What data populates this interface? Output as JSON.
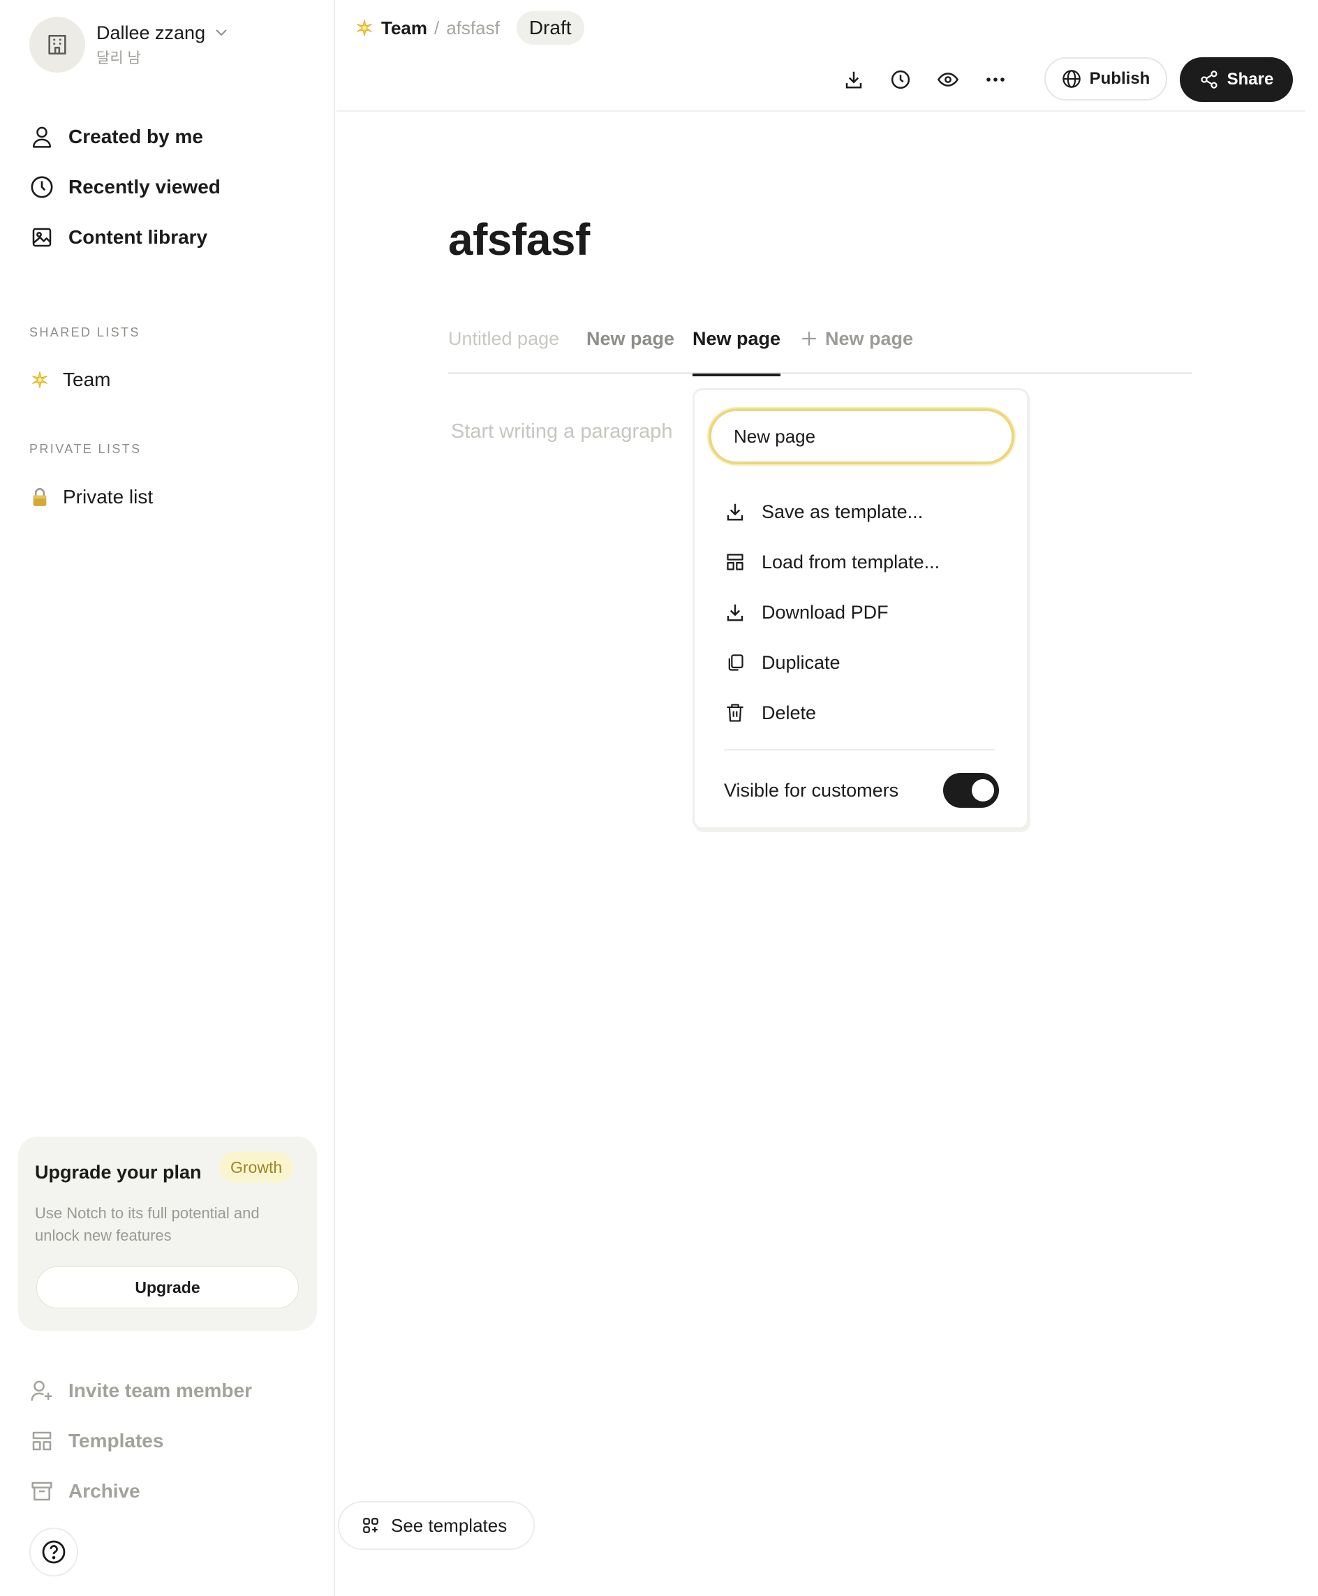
{
  "workspace": {
    "name": "Dallee zzang",
    "subtitle": "달리 남",
    "avatar_icon": "building-icon"
  },
  "sidebar": {
    "nav": [
      {
        "label": "Created by me",
        "icon": "user-icon"
      },
      {
        "label": "Recently viewed",
        "icon": "clock-icon"
      },
      {
        "label": "Content library",
        "icon": "image-icon"
      }
    ],
    "shared_title": "SHARED LISTS",
    "shared_lists": [
      {
        "label": "Team",
        "icon": "sparkle-emoji"
      }
    ],
    "private_title": "PRIVATE LISTS",
    "private_lists": [
      {
        "label": "Private list",
        "icon": "lock-emoji"
      }
    ],
    "upgrade": {
      "title": "Upgrade your plan",
      "badge": "Growth",
      "description": "Use Notch to its full potential and unlock new features",
      "button": "Upgrade"
    },
    "bottom": [
      {
        "label": "Invite team member",
        "icon": "user-plus-icon"
      },
      {
        "label": "Templates",
        "icon": "template-icon"
      },
      {
        "label": "Archive",
        "icon": "archive-icon"
      }
    ],
    "help_icon": "help-icon"
  },
  "header": {
    "breadcrumb_team": "Team",
    "breadcrumb_sep": "/",
    "breadcrumb_page": "afsfasf",
    "status": "Draft",
    "tools": [
      "download-icon",
      "history-icon",
      "eye-icon",
      "more-icon"
    ],
    "publish": "Publish",
    "share": "Share"
  },
  "document": {
    "title": "afsfasf",
    "tabs": [
      "Untitled page",
      "New page",
      "New page"
    ],
    "active_tab": 2,
    "add_tab": "New page",
    "placeholder": "Start writing a paragraph"
  },
  "popover": {
    "input_value": "New page",
    "items": [
      {
        "label": "Save as template...",
        "icon": "save-template-icon"
      },
      {
        "label": "Load from template...",
        "icon": "load-template-icon"
      },
      {
        "label": "Download PDF",
        "icon": "download-icon"
      },
      {
        "label": "Duplicate",
        "icon": "duplicate-icon"
      },
      {
        "label": "Delete",
        "icon": "trash-icon"
      }
    ],
    "visible_label": "Visible for customers",
    "visible_on": true
  },
  "footer": {
    "see_templates": "See templates"
  },
  "colors": {
    "accent_input": "#ecd77a",
    "badge_bg": "#fbf5cf",
    "dark_button": "#1c1c1c"
  }
}
